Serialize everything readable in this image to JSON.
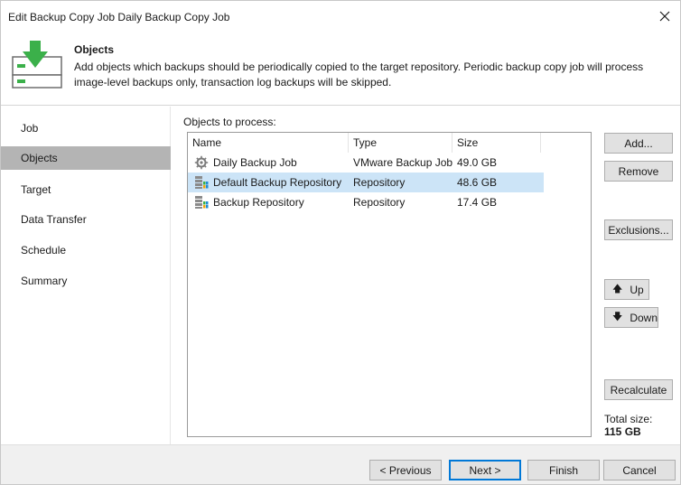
{
  "window": {
    "title": "Edit Backup Copy Job Daily Backup Copy Job"
  },
  "header": {
    "title": "Objects",
    "description_line1": "Add objects which backups should be periodically copied to the target repository. Periodic backup copy job will process",
    "description_line2": "image-level backups only, transaction log backups will be skipped."
  },
  "sidebar": {
    "items": [
      {
        "label": "Job"
      },
      {
        "label": "Objects"
      },
      {
        "label": "Target"
      },
      {
        "label": "Data Transfer"
      },
      {
        "label": "Schedule"
      },
      {
        "label": "Summary"
      }
    ],
    "active": "Objects"
  },
  "objects": {
    "label": "Objects to process:",
    "columns": {
      "name": "Name",
      "type": "Type",
      "size": "Size"
    },
    "rows": [
      {
        "name": "Daily Backup Job",
        "type": "VMware Backup Job",
        "size": "49.0 GB",
        "icon": "backup-job-icon"
      },
      {
        "name": "Default Backup Repository",
        "type": "Repository",
        "size": "48.6 GB",
        "icon": "repository-icon"
      },
      {
        "name": "Backup Repository",
        "type": "Repository",
        "size": "17.4 GB",
        "icon": "repository-icon"
      }
    ],
    "selected_row": 1
  },
  "buttons": {
    "add": "Add...",
    "remove": "Remove",
    "exclusions": "Exclusions...",
    "up": "Up",
    "down": "Down",
    "recalculate": "Recalculate"
  },
  "total": {
    "label": "Total size:",
    "value": "115 GB"
  },
  "footer": {
    "previous": "< Previous",
    "next": "Next >",
    "finish": "Finish",
    "cancel": "Cancel"
  },
  "colors": {
    "selection": "#cce4f7",
    "nav_active": "#b4b4b4",
    "primary_border": "#0078d7",
    "icon_green": "#3bb04a",
    "icon_blue": "#1f8dd6"
  }
}
